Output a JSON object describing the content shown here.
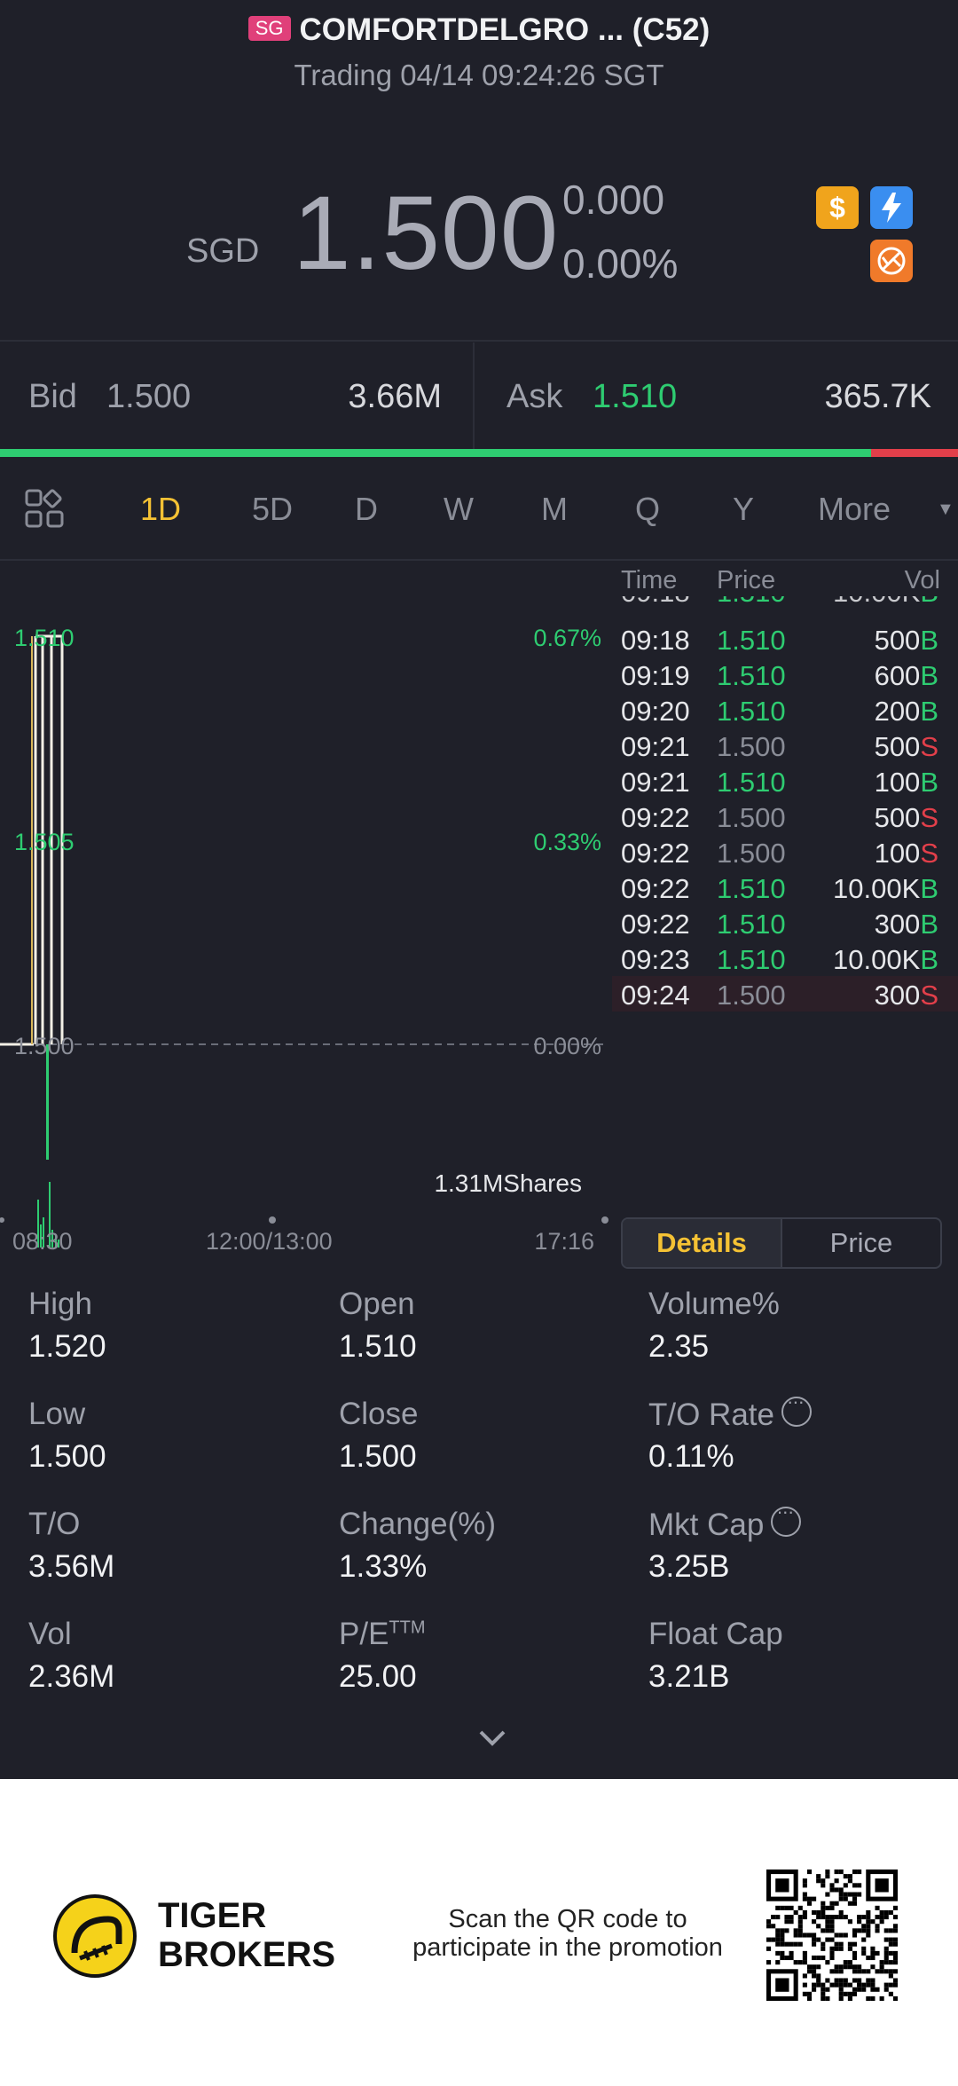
{
  "header": {
    "market_badge": "SG",
    "title": "COMFORTDELGRO ... (C52)",
    "status": "Trading 04/14 09:24:26 SGT",
    "currency": "SGD",
    "price": "1.500",
    "change": "0.000",
    "change_pct": "0.00%",
    "badges": [
      "dollar-icon",
      "lightning-icon",
      "no-short-icon"
    ]
  },
  "quote": {
    "bid_label": "Bid",
    "bid_price": "1.500",
    "bid_size": "3.66M",
    "ask_label": "Ask",
    "ask_price": "1.510",
    "ask_size": "365.7K",
    "bid_share": 0.909
  },
  "tabs": {
    "items": [
      "1D",
      "5D",
      "D",
      "W",
      "M",
      "Q",
      "Y",
      "More"
    ],
    "active": "1D"
  },
  "chart": {
    "price_labels": [
      "1.510",
      "1.505",
      "1.500"
    ],
    "pct_labels": [
      "0.67%",
      "0.33%",
      "0.00%"
    ],
    "volume_label": "1.31MShares",
    "time_labels": [
      "08:30",
      "12:00/13:00",
      "17:16"
    ]
  },
  "chart_data": {
    "type": "line",
    "ylim": [
      1.5,
      1.51
    ],
    "prev_close": 1.5,
    "volume_total": "1.31MShares"
  },
  "ticks": {
    "headers": {
      "time": "Time",
      "price": "Price",
      "vol": "Vol"
    },
    "rows": [
      {
        "time": "09:18",
        "price": "1.510",
        "vol": "500",
        "side": "B"
      },
      {
        "time": "09:19",
        "price": "1.510",
        "vol": "600",
        "side": "B"
      },
      {
        "time": "09:20",
        "price": "1.510",
        "vol": "200",
        "side": "B"
      },
      {
        "time": "09:21",
        "price": "1.500",
        "vol": "500",
        "side": "S"
      },
      {
        "time": "09:21",
        "price": "1.510",
        "vol": "100",
        "side": "B"
      },
      {
        "time": "09:22",
        "price": "1.500",
        "vol": "500",
        "side": "S"
      },
      {
        "time": "09:22",
        "price": "1.500",
        "vol": "100",
        "side": "S"
      },
      {
        "time": "09:22",
        "price": "1.510",
        "vol": "10.00K",
        "side": "B"
      },
      {
        "time": "09:22",
        "price": "1.510",
        "vol": "300",
        "side": "B"
      },
      {
        "time": "09:23",
        "price": "1.510",
        "vol": "10.00K",
        "side": "B"
      },
      {
        "time": "09:24",
        "price": "1.500",
        "vol": "300",
        "side": "S"
      }
    ],
    "buttons": {
      "details": "Details",
      "price": "Price"
    }
  },
  "stats": [
    {
      "label": "High",
      "value": "1.520"
    },
    {
      "label": "Open",
      "value": "1.510"
    },
    {
      "label": "Volume%",
      "value": "2.35"
    },
    {
      "label": "Low",
      "value": "1.500"
    },
    {
      "label": "Close",
      "value": "1.500"
    },
    {
      "label": "T/O Rate",
      "value": "0.11%",
      "info": true
    },
    {
      "label": "T/O",
      "value": "3.56M"
    },
    {
      "label": "Change(%)",
      "value": "1.33%"
    },
    {
      "label": "Mkt Cap",
      "value": "3.25B",
      "info": true
    },
    {
      "label": "Vol",
      "value": "2.36M"
    },
    {
      "label": "P/E",
      "sup": "TTM",
      "value": "25.00"
    },
    {
      "label": "Float Cap",
      "value": "3.21B"
    }
  ],
  "footer": {
    "brand_line1": "TIGER",
    "brand_line2": "BROKERS",
    "promo_line1": "Scan the QR code to",
    "promo_line2": "participate in the promotion"
  },
  "colors": {
    "up": "#2ecc71",
    "down": "#e23f4a",
    "accent": "#f5c234",
    "background": "#1f2029"
  }
}
